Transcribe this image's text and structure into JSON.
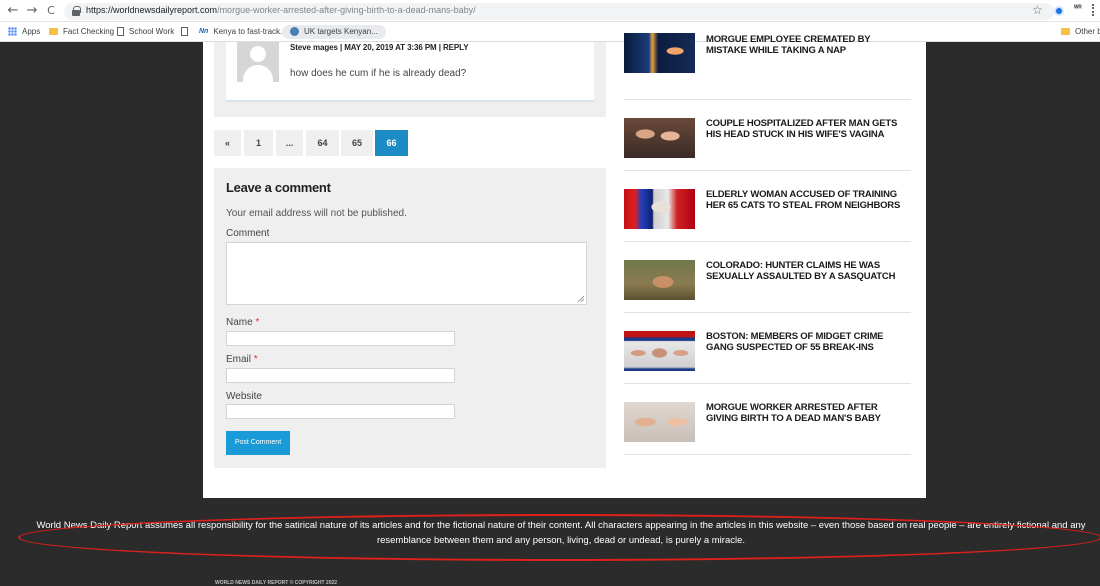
{
  "browser": {
    "back": "←",
    "forward": "→",
    "reload": "C",
    "url_domain": "https://worldnewsdailyreport.com",
    "url_path": "/morgue-worker-arrested-after-giving-birth-to-a-dead-mans-baby/",
    "star": "☆",
    "ext_label": "ᵂᴿ",
    "bookmarks": [
      "Apps",
      "Fact Checking",
      "School Work",
      "Kenya to fast-track...",
      "UK targets Kenyan...",
      "Other b"
    ]
  },
  "comment": {
    "meta": "Steve mages | MAY 20, 2019 AT 3:36 PM | REPLY",
    "text": "how does he cum if he is already dead?"
  },
  "pagination": [
    "«",
    "1",
    "...",
    "64",
    "65",
    "66"
  ],
  "form": {
    "title": "Leave a comment",
    "note": "Your email address will not be published.",
    "comment_label": "Comment",
    "name_label": "Name",
    "email_label": "Email",
    "website_label": "Website",
    "required_mark": "*",
    "submit": "Post Comment"
  },
  "sidebar": [
    {
      "title": "MORGUE EMPLOYEE CREMATED BY MISTAKE WHILE TAKING A NAP"
    },
    {
      "title": "COUPLE HOSPITALIZED AFTER MAN GETS HIS HEAD STUCK IN HIS WIFE'S VAGINA"
    },
    {
      "title": "ELDERLY WOMAN ACCUSED OF TRAINING HER 65 CATS TO STEAL FROM NEIGHBORS"
    },
    {
      "title": "COLORADO: HUNTER CLAIMS HE WAS SEXUALLY ASSAULTED BY A SASQUATCH"
    },
    {
      "title": "BOSTON: MEMBERS OF MIDGET CRIME GANG SUSPECTED OF 55 BREAK-INS"
    },
    {
      "title": "MORGUE WORKER ARRESTED AFTER GIVING BIRTH TO A DEAD MAN'S BABY"
    }
  ],
  "footer": {
    "disclaimer": "World News Daily Report assumes all responsibility for the satirical nature of its articles and for the fictional nature of their content. All characters appearing in the articles in this website – even those based on real people – are entirely fictional and any resemblance between them and any person, living, dead or undead, is purely a miracle.",
    "copyright": "WORLD NEWS DAILY REPORT © COPYRIGHT 2022"
  }
}
